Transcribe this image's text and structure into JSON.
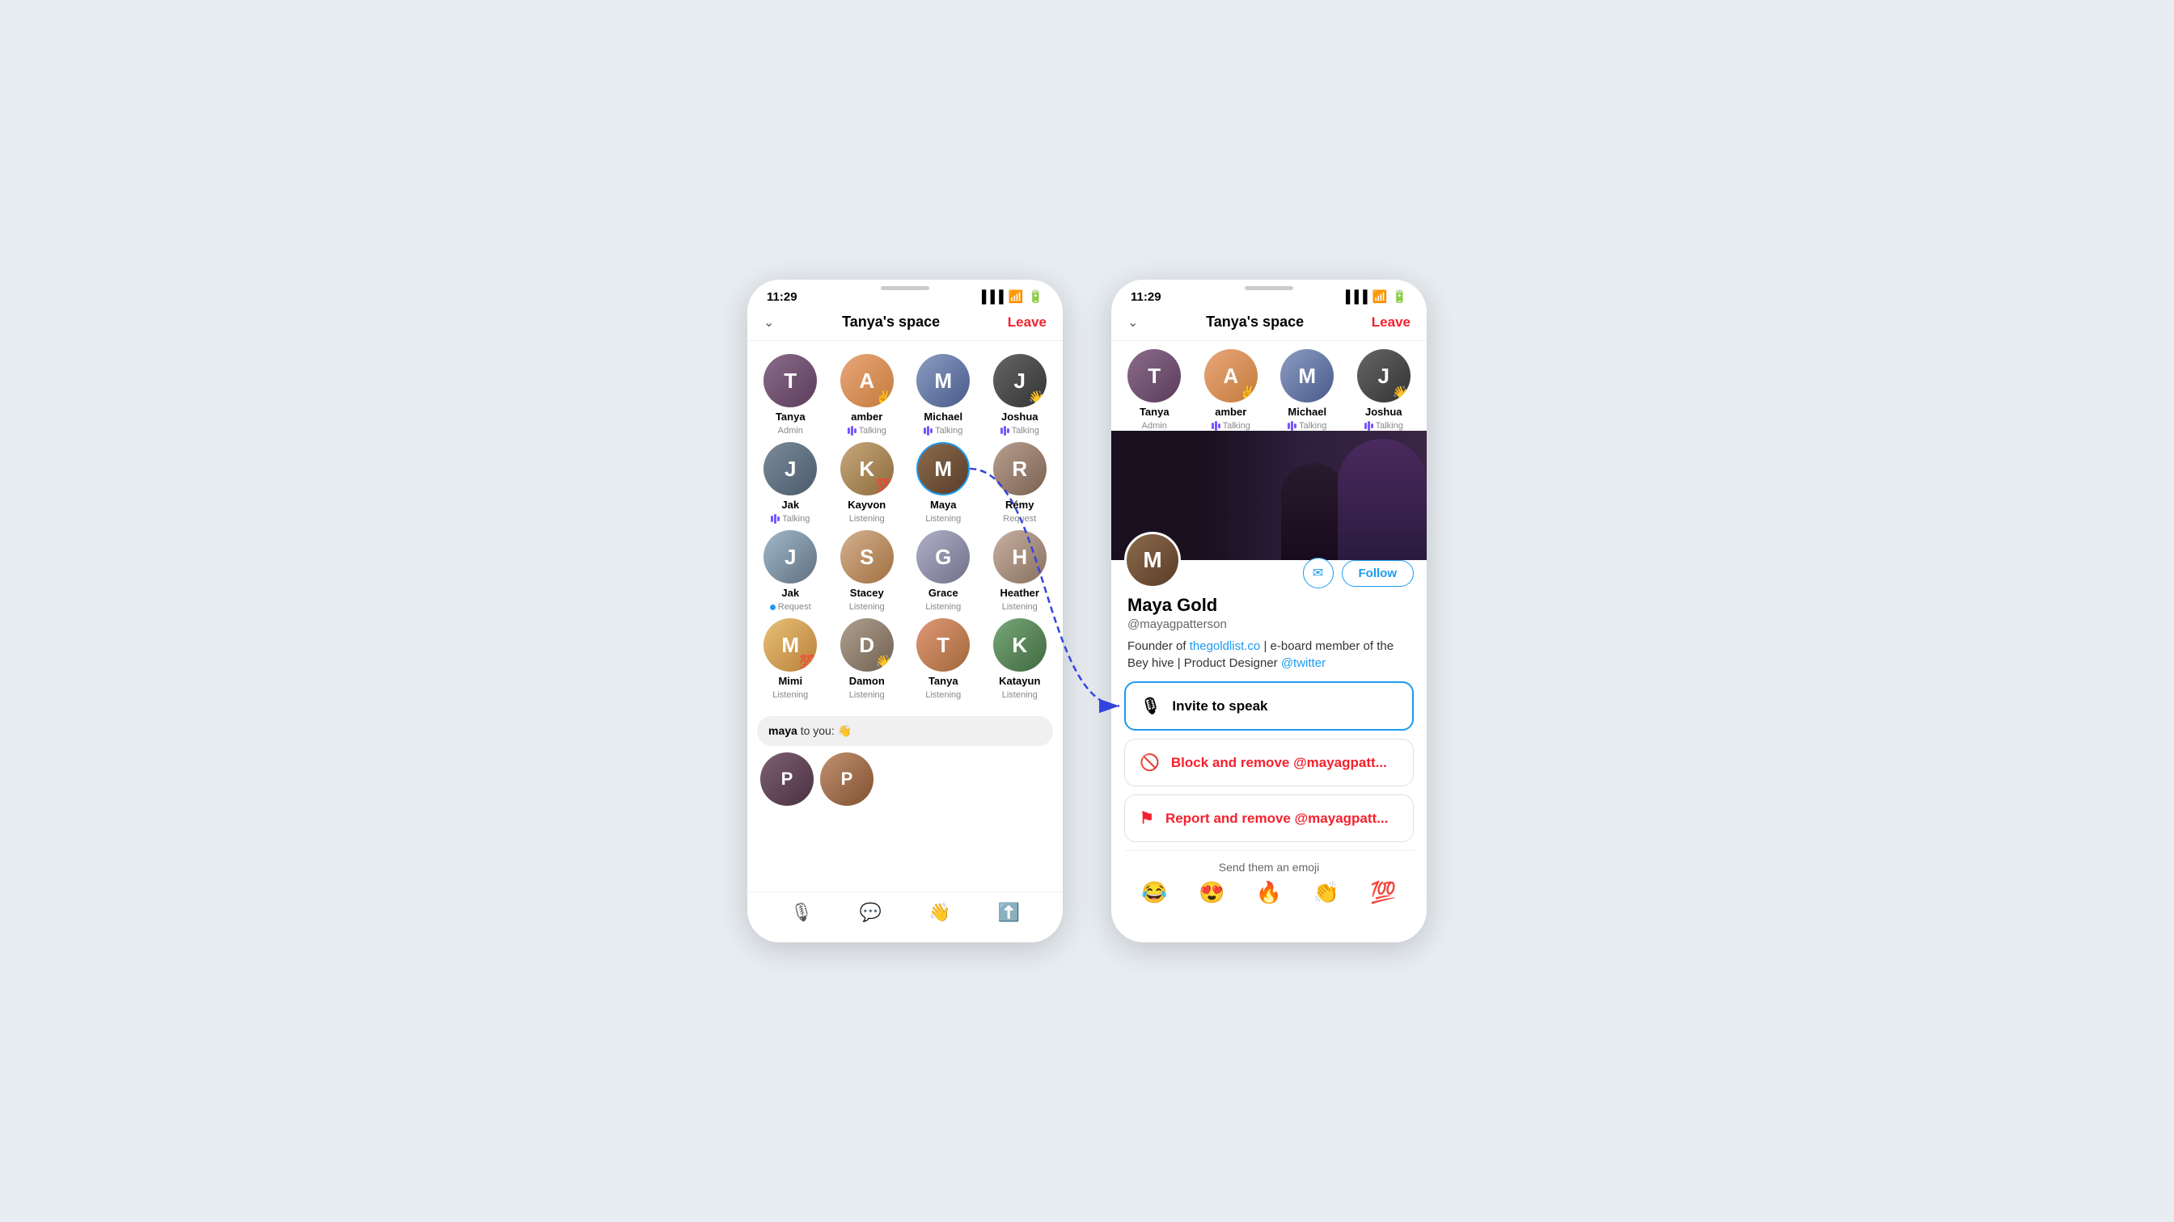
{
  "scene": {
    "background": "#e8edf2"
  },
  "left_phone": {
    "status_bar": {
      "time": "11:29"
    },
    "header": {
      "title": "Tanya's space",
      "leave_label": "Leave"
    },
    "participants": [
      {
        "name": "Tanya",
        "status": "Admin",
        "status_type": "admin",
        "avatar_class": "av-tanya",
        "emoji": ""
      },
      {
        "name": "amber",
        "status": "Talking",
        "status_type": "talking",
        "avatar_class": "av-amber",
        "emoji": "✌️"
      },
      {
        "name": "Michael",
        "status": "Talking",
        "status_type": "talking",
        "avatar_class": "av-michael",
        "emoji": ""
      },
      {
        "name": "Joshua",
        "status": "Talking",
        "status_type": "talking",
        "avatar_class": "av-joshua",
        "emoji": "👋"
      },
      {
        "name": "Jak",
        "status": "Talking",
        "status_type": "talking",
        "avatar_class": "av-jak",
        "emoji": ""
      },
      {
        "name": "Kayvon",
        "status": "Listening",
        "status_type": "listening",
        "avatar_class": "av-kayvon",
        "emoji": "💯"
      },
      {
        "name": "Maya",
        "status": "Listening",
        "status_type": "listening",
        "avatar_class": "av-maya",
        "emoji": "",
        "selected": true
      },
      {
        "name": "Rémy",
        "status": "Request",
        "status_type": "request",
        "avatar_class": "av-remy",
        "emoji": ""
      },
      {
        "name": "Jak",
        "status": "Request",
        "status_type": "request_dot",
        "avatar_class": "av-jak2",
        "emoji": ""
      },
      {
        "name": "Stacey",
        "status": "Listening",
        "status_type": "listening",
        "avatar_class": "av-stacey",
        "emoji": ""
      },
      {
        "name": "Grace",
        "status": "Listening",
        "status_type": "listening",
        "avatar_class": "av-grace",
        "emoji": ""
      },
      {
        "name": "Heather",
        "status": "Listening",
        "status_type": "listening",
        "avatar_class": "av-heather",
        "emoji": ""
      },
      {
        "name": "Mimi",
        "status": "Listening",
        "status_type": "listening",
        "avatar_class": "av-mimi",
        "emoji": "💯"
      },
      {
        "name": "Damon",
        "status": "Listening",
        "status_type": "listening",
        "avatar_class": "av-damon",
        "emoji": "👋"
      },
      {
        "name": "Tanya",
        "status": "Listening",
        "status_type": "listening",
        "avatar_class": "av-tanya2",
        "emoji": ""
      },
      {
        "name": "Katayun",
        "status": "Listening",
        "status_type": "listening",
        "avatar_class": "av-katayun",
        "emoji": ""
      }
    ],
    "chat_bubble": {
      "sender": "maya",
      "message": " to you: 👋"
    },
    "bottom_icons": [
      "🎤",
      "💬",
      "👋",
      "⬆️"
    ]
  },
  "right_phone": {
    "status_bar": {
      "time": "11:29"
    },
    "header": {
      "title": "Tanya's space",
      "leave_label": "Leave"
    },
    "participants": [
      {
        "name": "Tanya",
        "status": "Admin",
        "status_type": "admin",
        "avatar_class": "av-tanya",
        "emoji": ""
      },
      {
        "name": "amber",
        "status": "Talking",
        "status_type": "talking",
        "avatar_class": "av-amber",
        "emoji": "✌️"
      },
      {
        "name": "Michael",
        "status": "Talking",
        "status_type": "talking",
        "avatar_class": "av-michael",
        "emoji": ""
      },
      {
        "name": "Joshua",
        "status": "Talking",
        "status_type": "talking",
        "avatar_class": "av-joshua",
        "emoji": "👋"
      }
    ],
    "profile": {
      "name": "Maya Gold",
      "handle": "@mayagpatterson",
      "bio_text": "Founder of ",
      "bio_link": "thegoldlist.co",
      "bio_mid": " | e-board member of the Bey hive | Product Designer ",
      "bio_link2": "@twitter",
      "follow_label": "Follow",
      "mail_icon": "✉"
    },
    "actions": [
      {
        "label": "Invite to speak",
        "icon": "🎙",
        "type": "highlight"
      },
      {
        "label": "Block and remove @mayagpatt...",
        "icon": "🚫",
        "type": "danger"
      },
      {
        "label": "Report and remove @mayagpatt...",
        "icon": "⚑",
        "type": "danger"
      }
    ],
    "emoji_section": {
      "label": "Send them an emoji",
      "emojis": [
        "😂",
        "😍",
        "🔥",
        "👏",
        "💯"
      ]
    }
  }
}
